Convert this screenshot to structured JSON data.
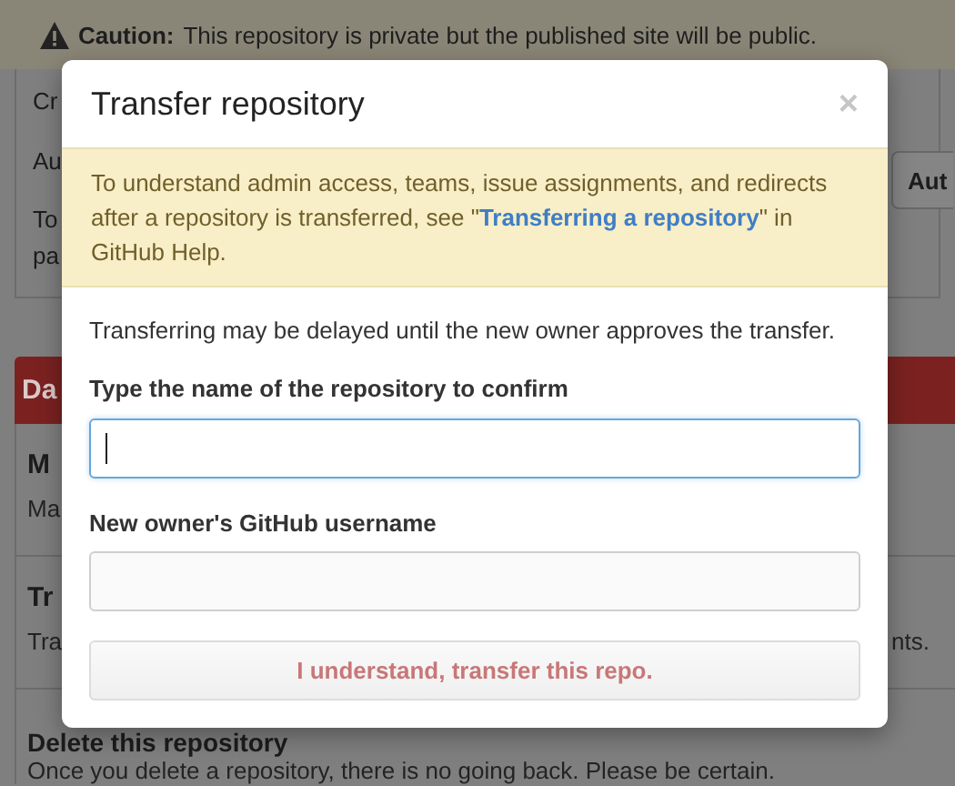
{
  "background_page": {
    "caution": {
      "label": "Caution:",
      "text": "This repository is private but the published site will be public."
    },
    "option_fragments": [
      "Cr",
      "Au",
      "To",
      "pa"
    ],
    "side_button": "Aut",
    "danger_zone": {
      "title": "Da",
      "items": [
        {
          "title": "M",
          "description": "Ma"
        },
        {
          "title": "Tr",
          "description": "Tra",
          "description_end": "nts."
        },
        {
          "title": "Delete this repository",
          "description": "Once you delete a repository, there is no going back. Please be certain."
        }
      ]
    }
  },
  "modal": {
    "title": "Transfer repository",
    "close": "×",
    "notice": {
      "before": "To understand admin access, teams, issue assignments, and redirects after a repository is transferred, see \"",
      "link": "Transferring a repository",
      "after": "\" in GitHub Help."
    },
    "message": "Transferring may be delayed until the new owner approves the transfer.",
    "fields": [
      {
        "label": "Type the name of the repository to confirm",
        "focused": true
      },
      {
        "label": "New owner's GitHub username",
        "focused": false
      }
    ],
    "button": {
      "label": "I understand, transfer this repo.",
      "disabled": true
    }
  }
}
